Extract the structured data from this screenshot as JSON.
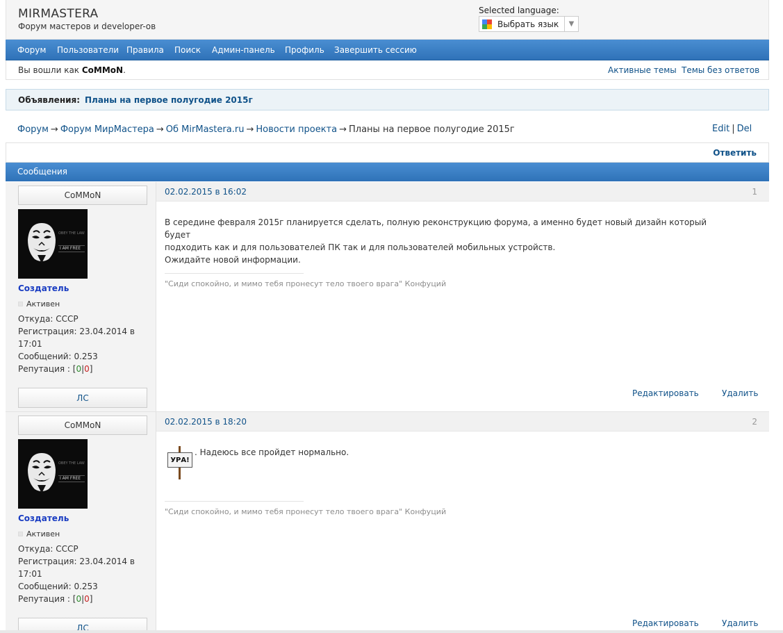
{
  "header": {
    "title": "MIRMASTERA",
    "subtitle": "Форум мастеров и developer-ов",
    "language_label": "Selected language:",
    "language_select": "Выбрать язык",
    "language_arrow": "▼"
  },
  "nav": {
    "items": [
      "Форум",
      "Пользователи",
      "Правила",
      "Поиск",
      "Админ-панель",
      "Профиль",
      "Завершить сессию"
    ]
  },
  "userbar": {
    "logged_prefix": "Вы вошли как ",
    "username": "CoMMoN",
    "logged_suffix": ".",
    "active_topics": "Активные темы",
    "unanswered": "Темы без ответов"
  },
  "announcement": {
    "label": "Объявления:",
    "value": "Планы на первое полугодие 2015г"
  },
  "breadcrumb": {
    "items": [
      "Форум",
      "Форум МирМастера",
      "Об MirMastera.ru",
      "Новости проекта",
      "Планы на первое полугодие 2015г"
    ],
    "separator": "→"
  },
  "topic_actions": {
    "edit": "Edit",
    "divider": "|",
    "del": "Del",
    "reply": "Ответить"
  },
  "messages_header": "Сообщения",
  "posts": [
    {
      "author": "CoMMoN",
      "rank": "Создатель",
      "status": "Активен",
      "from": "Откуда: СССР",
      "registered": "Регистрация: 23.04.2014 в 17:01",
      "message_count": "Сообщений: 0.253",
      "reputation_label": "Репутация : [",
      "rep_plus": "0",
      "rep_sep": "|",
      "rep_minus": "0",
      "rep_close": "]",
      "pm_button": "ЛС",
      "date": "02.02.2015 в 16:02",
      "number": "1",
      "text_lines": [
        "В середине февраля 2015г планируется сделать, полную реконструкцию форума, а именно будет новый дизайн который будет",
        "подходить как и для пользователей ПК так и для пользователей мобильных устройств.",
        "Ожидайте новой информации."
      ],
      "signature": "\"Сиди спокойно, и мимо тебя пронесут тело твоего врага\"  Конфуций",
      "edit": "Редактировать",
      "delete": "Удалить"
    },
    {
      "author": "CoMMoN",
      "rank": "Создатель",
      "status": "Активен",
      "from": "Откуда: СССР",
      "registered": "Регистрация: 23.04.2014 в 17:01",
      "message_count": "Сообщений: 0.253",
      "reputation_label": "Репутация : [",
      "rep_plus": "0",
      "rep_sep": "|",
      "rep_minus": "0",
      "rep_close": "]",
      "pm_button": "ЛС",
      "date": "02.02.2015 в 18:20",
      "number": "2",
      "smiley_text": "УРА!",
      "text": ". Надеюсь все пройдет нормально.",
      "signature": "\"Сиди спокойно, и мимо тебя пронесут тело твоего врага\"  Конфуций",
      "edit": "Редактировать",
      "delete": "Удалить"
    }
  ],
  "avatar_text": [
    "OBEY THE LAW",
    "I AM FREE"
  ],
  "colors": {
    "nav_blue": "#2f72b8",
    "link": "#105289",
    "rank": "#1a3dc2",
    "rep_plus": "#2a8a2a",
    "rep_minus": "#c51e1e"
  }
}
